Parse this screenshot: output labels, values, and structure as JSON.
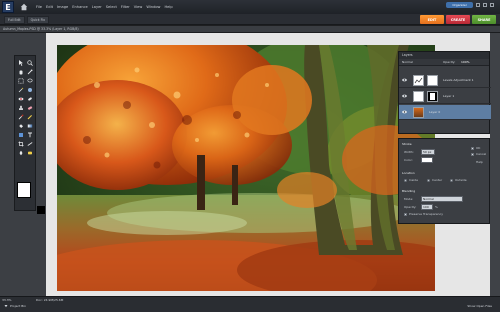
{
  "app": {
    "logo_letter": "E",
    "menus": [
      "File",
      "Edit",
      "Image",
      "Enhance",
      "Layer",
      "Select",
      "Filter",
      "View",
      "Window",
      "Help"
    ],
    "organizer_label": "Organizer",
    "subtabs": [
      "Full Edit",
      "Quick Fix"
    ],
    "modes": [
      "EDIT",
      "CREATE",
      "SHARE"
    ],
    "doc_title": "Autumn_Maples.PSD @ 33.3% (Layer 1, RGB/8)"
  },
  "layers_panel": {
    "title": "Layers",
    "blend_label": "Normal",
    "opacity_label": "Opacity:",
    "opacity_value": "100%",
    "rows": [
      {
        "name": "Levels Adjustment 1",
        "active": false
      },
      {
        "name": "Layer 1",
        "active": false
      },
      {
        "name": "Layer 0",
        "active": true
      }
    ]
  },
  "options_panel": {
    "title": "Stroke",
    "width_label": "Width:",
    "width_value": "50 px",
    "color_label": "Color:",
    "ok_label": "OK",
    "cancel_label": "Cancel",
    "help_label": "Help",
    "location_title": "Location",
    "location_options": [
      "Inside",
      "Center",
      "Outside"
    ],
    "blending_title": "Blending",
    "mode_label": "Mode:",
    "mode_value": "Normal",
    "opacity_label": "Opacity:",
    "opacity_value": "100",
    "opacity_unit": "%",
    "preserve_label": "Preserve Transparency"
  },
  "status": {
    "zoom": "33.3%",
    "doc_info": "Doc: 24.9M/25.6M",
    "project_bin": "Project Bin",
    "bin_right": "Show Open Files"
  },
  "colors": {
    "edit_mode": "#f08428",
    "create_mode": "#d23440",
    "share_mode": "#5fa33a",
    "active_layer": "#5e7ea3"
  }
}
